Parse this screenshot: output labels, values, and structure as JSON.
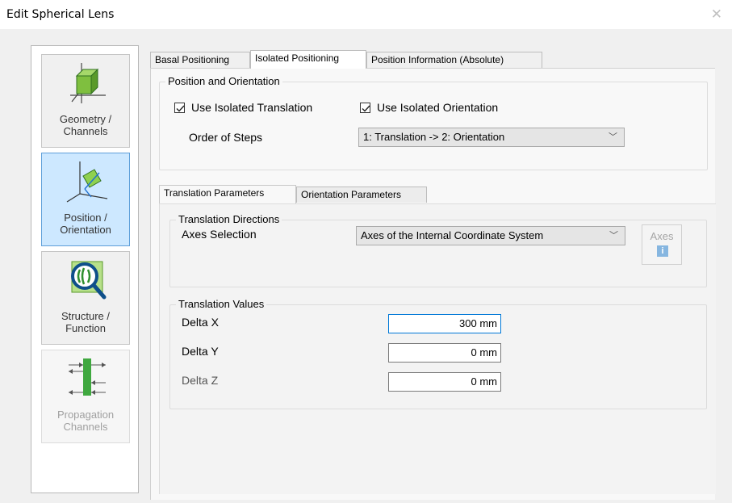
{
  "window": {
    "title": "Edit Spherical Lens",
    "close_glyph": "✕"
  },
  "sidebar": {
    "items": [
      {
        "label_line1": "Geometry /",
        "label_line2": "Channels",
        "icon": "geometry-icon"
      },
      {
        "label_line1": "Position /",
        "label_line2": "Orientation",
        "icon": "position-orientation-icon",
        "selected": true
      },
      {
        "label_line1": "Structure /",
        "label_line2": "Function",
        "icon": "structure-function-icon"
      },
      {
        "label_line1": "Propagation",
        "label_line2": "Channels",
        "icon": "propagation-channels-icon",
        "disabled": true
      }
    ]
  },
  "tabs": [
    {
      "label": "Basal Positioning"
    },
    {
      "label": "Isolated Positioning",
      "active": true
    },
    {
      "label": "Position Information (Absolute)"
    }
  ],
  "position_orientation": {
    "legend": "Position and Orientation",
    "use_isolated_translation": {
      "label": "Use Isolated Translation",
      "checked": true
    },
    "use_isolated_orientation": {
      "label": "Use Isolated Orientation",
      "checked": true
    },
    "order_of_steps_label": "Order of Steps",
    "order_of_steps_value": "1: Translation -> 2: Orientation"
  },
  "subtabs": [
    {
      "label": "Translation Parameters",
      "active": true
    },
    {
      "label": "Orientation Parameters"
    }
  ],
  "translation_directions": {
    "legend": "Translation Directions",
    "axes_selection_label": "Axes Selection",
    "axes_selection_value": "Axes of the Internal Coordinate System",
    "axes_button_label": "Axes",
    "info_glyph": "i"
  },
  "translation_values": {
    "legend": "Translation Values",
    "delta_x": {
      "label": "Delta X",
      "value": "300 mm"
    },
    "delta_y": {
      "label": "Delta Y",
      "value": "0 mm"
    },
    "delta_z": {
      "label": "Delta Z",
      "value": "0 mm"
    }
  },
  "colors": {
    "selected_nav": "#cde8ff",
    "focus_border": "#0078d7",
    "window_bg": "#f0f0f0"
  }
}
